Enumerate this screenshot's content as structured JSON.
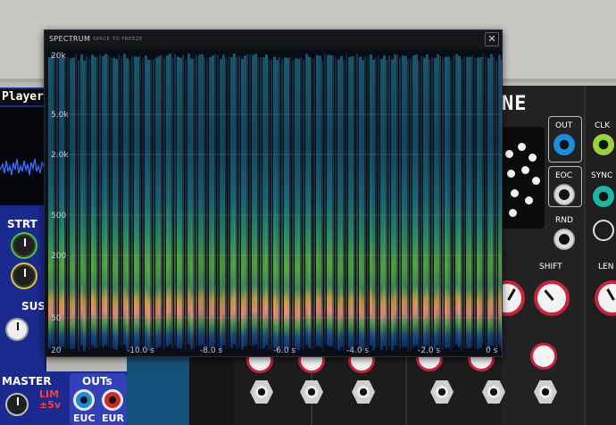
{
  "spectrum": {
    "title": "SPECTRUM",
    "hint": "SPACE TO FREEZE",
    "close_symbol": "✕",
    "y_axis_labels": [
      "20k",
      "5.0k",
      "2.0k",
      "500",
      "200",
      "50",
      "20"
    ],
    "x_axis_labels": [
      "-10.0 s",
      "-8.0 s",
      "-6.0 s",
      "-4.0 s",
      "-2.0 s",
      "0 s"
    ]
  },
  "player_module": {
    "title": "Player",
    "labels": {
      "strt": "STRT",
      "sus": "SUS"
    }
  },
  "master_section": {
    "master_label": "MASTER",
    "lim_label": "LIM",
    "lim_sub": "±5v",
    "outs_label": "OUTs",
    "euc_label": "EUC",
    "eur_label": "EUR"
  },
  "right_module": {
    "title": "NE",
    "out_label": "OUT",
    "eoc_label": "EOC",
    "rnd_label": "RND",
    "shift_label": "SHIFT",
    "clk_label": "CLK",
    "sync_label": "SYNC",
    "len_label": "LEN"
  },
  "colors": {
    "spectrum_bg": "#101214",
    "player_panel": "#1b2a8f",
    "knob_ring": "#c9243d",
    "scope_trace": "#3a6cff"
  }
}
